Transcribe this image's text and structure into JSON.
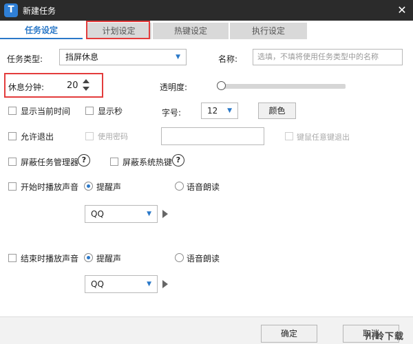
{
  "window": {
    "title": "新建任务",
    "close_glyph": "✕",
    "app_icon_letter": "T"
  },
  "tabs": [
    {
      "label": "任务设定",
      "active": true
    },
    {
      "label": "计划设定",
      "active": false
    },
    {
      "label": "热键设定",
      "active": false
    },
    {
      "label": "执行设定",
      "active": false
    }
  ],
  "task": {
    "type_label": "任务类型:",
    "type_value": "挡屏休息",
    "name_label": "名称:",
    "name_placeholder": "选填，不填将使用任务类型中的名称",
    "rest_minutes_label": "休息分钟:",
    "rest_minutes_value": "20",
    "opacity_label": "透明度:",
    "opacity_value": 0
  },
  "display": {
    "show_time_label": "显示当前时间",
    "show_seconds_label": "显示秒",
    "font_size_label": "字号:",
    "font_size_value": "12",
    "color_button": "颜色"
  },
  "exit": {
    "allow_exit_label": "允许退出",
    "use_password_label": "使用密码",
    "password_value": "",
    "any_key_exit_label": "键鼠任意键退出"
  },
  "block": {
    "task_manager_label": "屏蔽任务管理器",
    "system_hotkeys_label": "屏蔽系统热键",
    "help_glyph": "?"
  },
  "start_sound": {
    "label": "开始时播放声音",
    "option_alert": "提醒声",
    "option_voice": "语音朗读",
    "selected_sound": "QQ"
  },
  "end_sound": {
    "label": "结束时播放声音",
    "option_alert": "提醒声",
    "option_voice": "语音朗读",
    "selected_sound": "QQ"
  },
  "footer": {
    "ok_button": "确定",
    "cancel_button": "取消"
  },
  "watermark": "川岭下载网",
  "colors": {
    "titlebar": "#2b2b2b",
    "accent": "#2a78c8",
    "highlight": "#e33b3b"
  },
  "icons": {
    "dropdown": "chevron-down-icon",
    "play": "play-icon",
    "help": "help-circle-icon"
  }
}
